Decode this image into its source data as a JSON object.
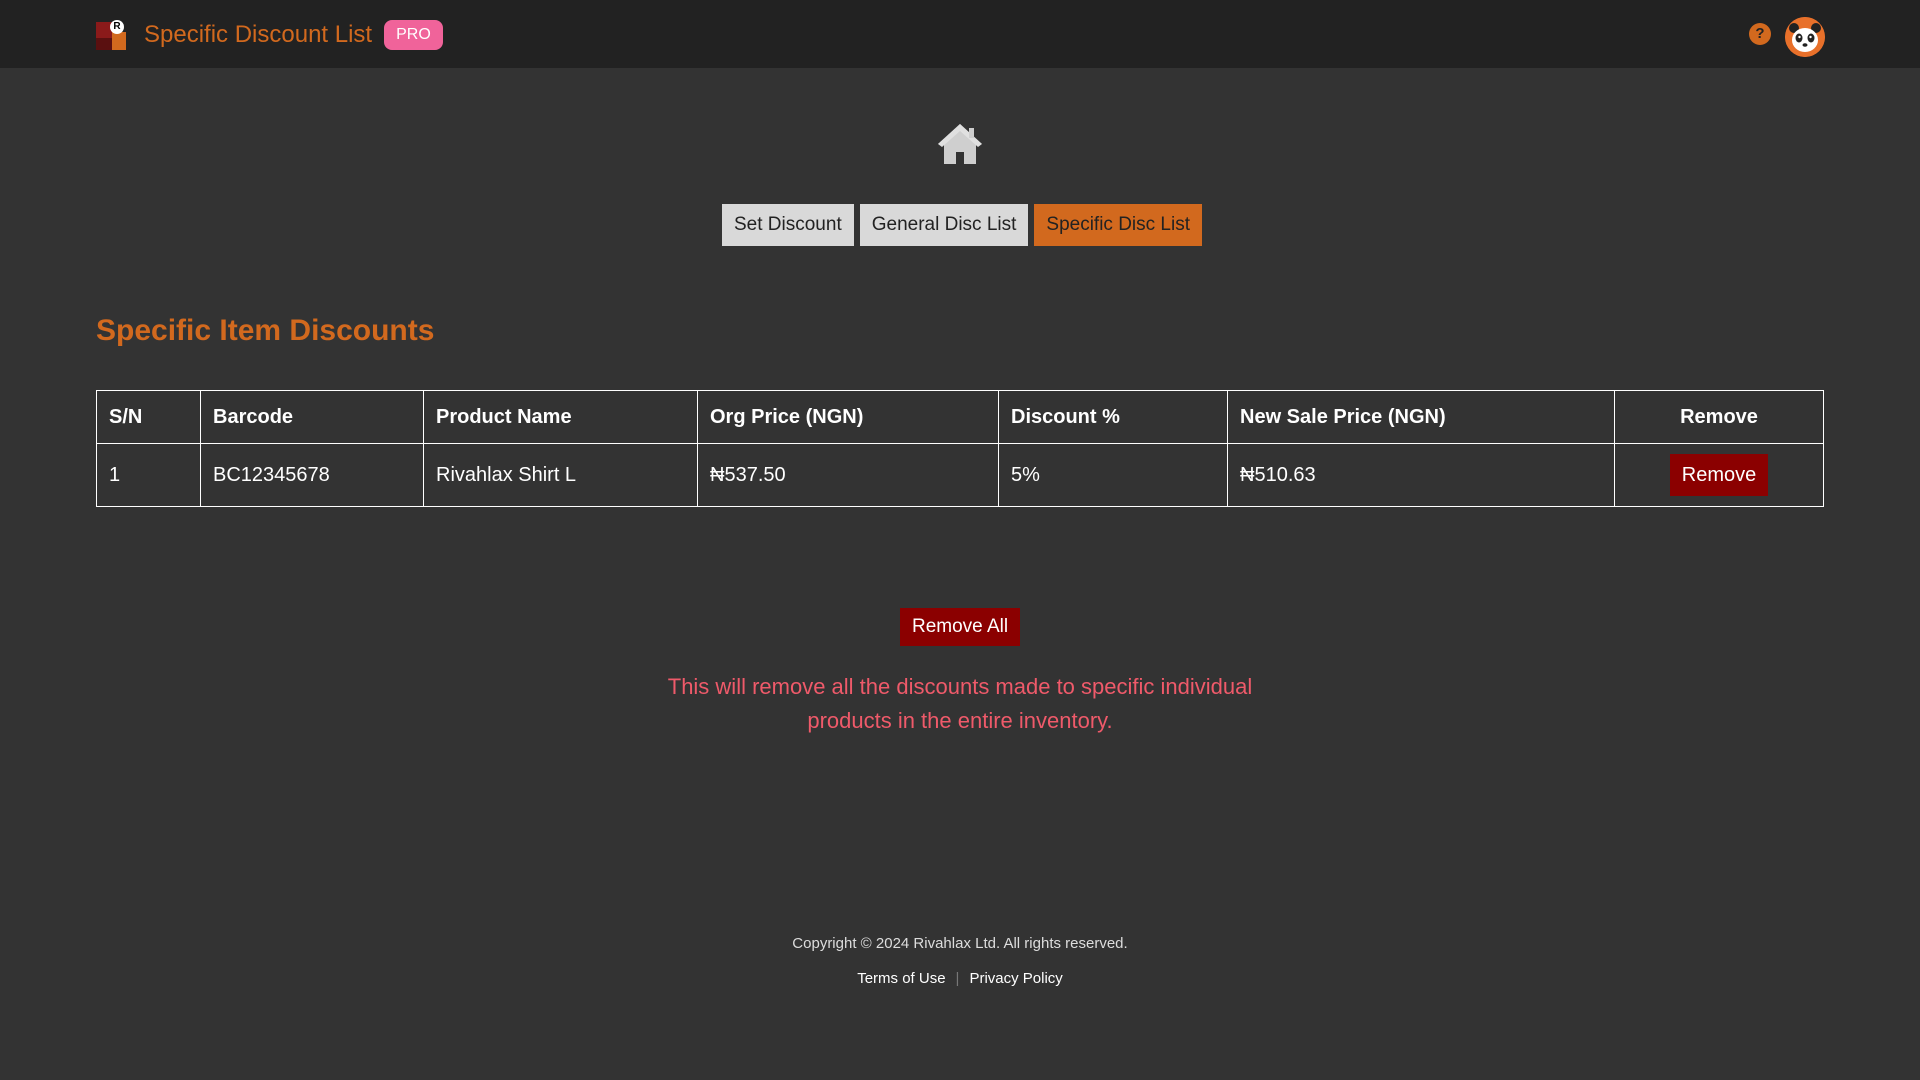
{
  "header": {
    "title": "Specific Discount List",
    "badge": "PRO",
    "logo_letter": "R",
    "help_icon": "question-circle-icon",
    "help_glyph": "?",
    "avatar_icon": "panda-avatar-icon"
  },
  "nav": {
    "home_icon": "home-icon",
    "tabs": [
      {
        "label": "Set Discount",
        "active": false
      },
      {
        "label": "General Disc List",
        "active": false
      },
      {
        "label": "Specific Disc List",
        "active": true
      }
    ]
  },
  "main": {
    "section_title": "Specific Item Discounts",
    "table": {
      "headers": [
        "S/N",
        "Barcode",
        "Product Name",
        "Org Price (NGN)",
        "Discount %",
        "New Sale Price (NGN)",
        "Remove"
      ],
      "rows": [
        {
          "sn": "1",
          "barcode": "BC12345678",
          "product_name": "Rivahlax Shirt L",
          "org_price": "₦537.50",
          "discount": "5%",
          "new_price": "₦510.63",
          "remove_label": "Remove"
        }
      ]
    },
    "remove_all_label": "Remove All",
    "warning_text": "This will remove all the discounts made to specific individual products in the entire inventory."
  },
  "footer": {
    "copyright": "Copyright © 2024 Rivahlax Ltd. All rights reserved.",
    "terms": "Terms of Use",
    "separator": "|",
    "privacy": "Privacy Policy"
  },
  "colors": {
    "accent": "#d2691e",
    "danger": "#8b0000",
    "badge": "#f0639a",
    "warning_text": "#ef5a6a",
    "background": "#333333",
    "topbar": "#222222"
  }
}
